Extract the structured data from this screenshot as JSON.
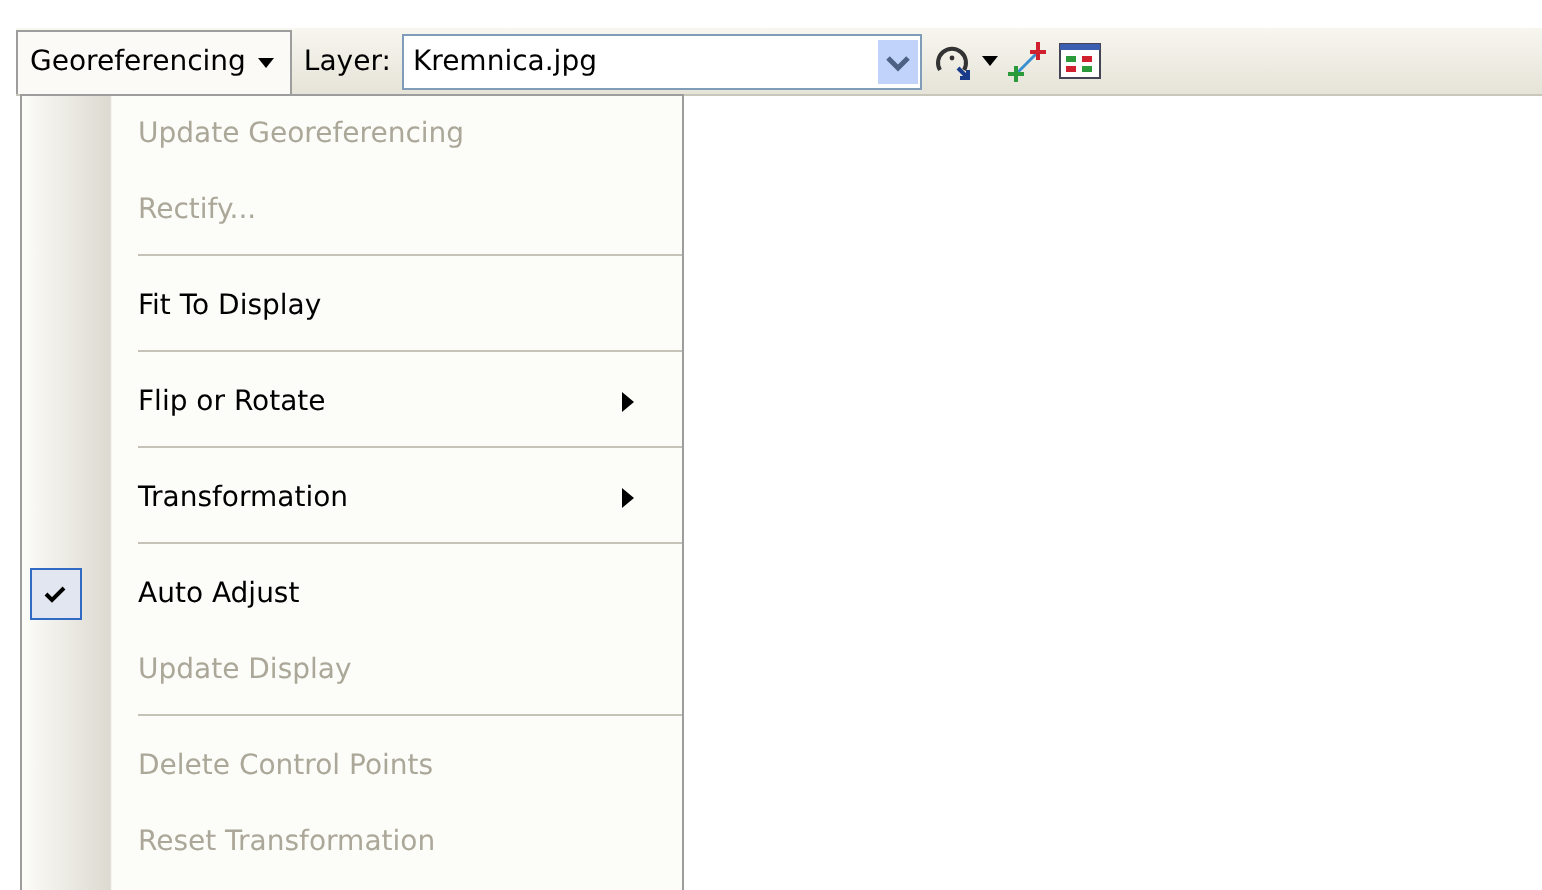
{
  "toolbar": {
    "menu_button": {
      "label": "Georeferencing",
      "expanded": true
    },
    "layer_label": "Layer:",
    "layer_value": "Kremnica.jpg"
  },
  "menu": [
    {
      "kind": "item",
      "label": "Update Georeferencing",
      "disabled": true,
      "checked": false,
      "submenu": false
    },
    {
      "kind": "item",
      "label": "Rectify...",
      "disabled": true,
      "checked": false,
      "submenu": false
    },
    {
      "kind": "separator"
    },
    {
      "kind": "item",
      "label": "Fit To Display",
      "disabled": false,
      "checked": false,
      "submenu": false
    },
    {
      "kind": "separator"
    },
    {
      "kind": "item",
      "label": "Flip or Rotate",
      "disabled": false,
      "checked": false,
      "submenu": true
    },
    {
      "kind": "separator"
    },
    {
      "kind": "item",
      "label": "Transformation",
      "disabled": false,
      "checked": false,
      "submenu": true
    },
    {
      "kind": "separator"
    },
    {
      "kind": "item",
      "label": "Auto Adjust",
      "disabled": false,
      "checked": true,
      "submenu": false
    },
    {
      "kind": "item",
      "label": "Update Display",
      "disabled": true,
      "checked": false,
      "submenu": false
    },
    {
      "kind": "separator"
    },
    {
      "kind": "item",
      "label": "Delete Control Points",
      "disabled": true,
      "checked": false,
      "submenu": false
    },
    {
      "kind": "item",
      "label": "Reset Transformation",
      "disabled": true,
      "checked": false,
      "submenu": false
    }
  ]
}
